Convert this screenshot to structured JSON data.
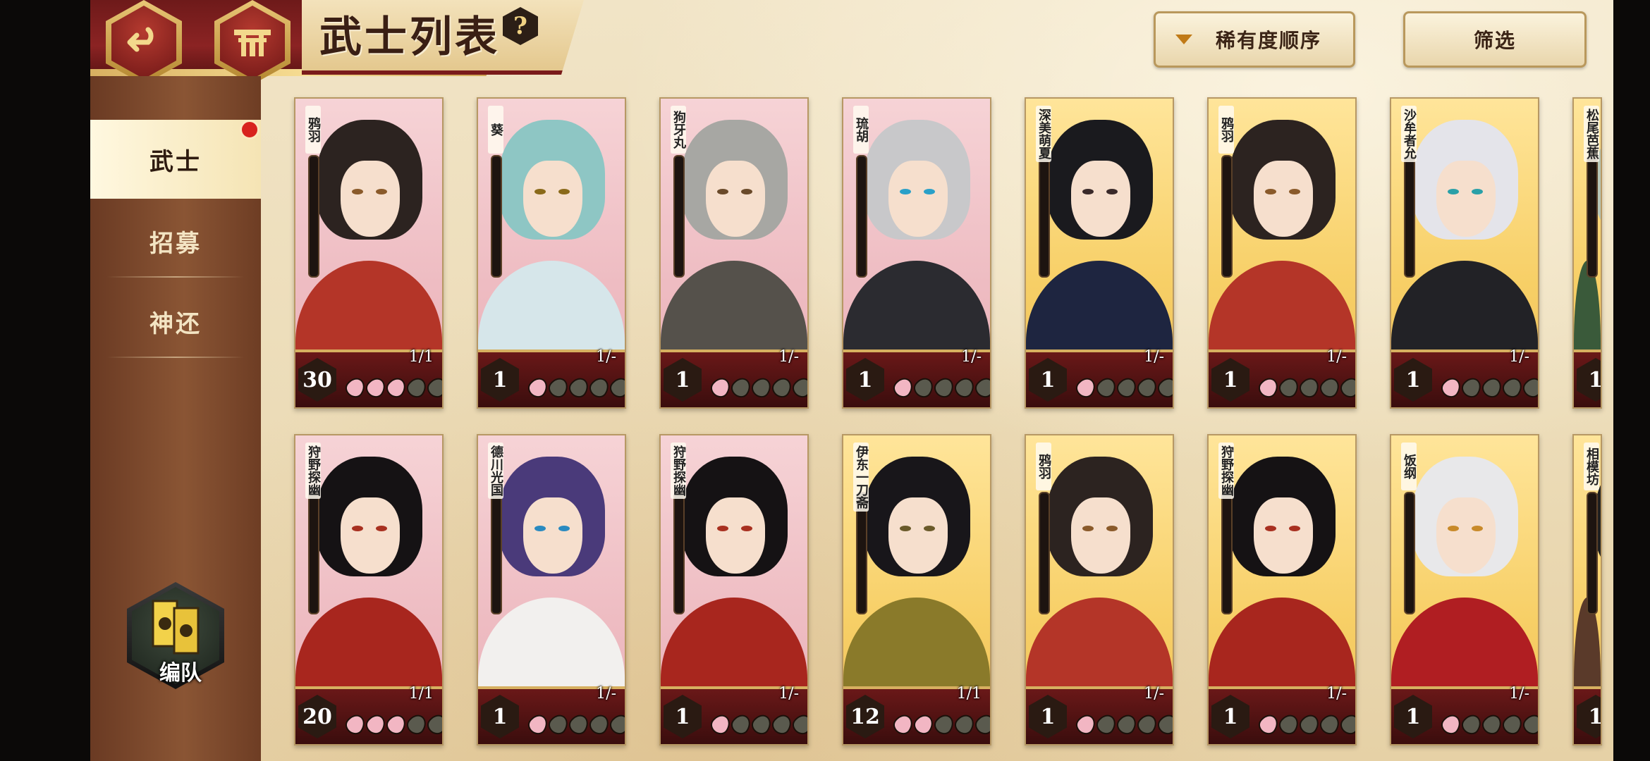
{
  "header": {
    "title": "武士列表",
    "help_label": "?",
    "sort_label": "稀有度顺序",
    "filter_label": "筛选"
  },
  "sidebar": {
    "tabs": [
      {
        "label": "武士",
        "active": true,
        "notification": true
      },
      {
        "label": "招募",
        "active": false
      },
      {
        "label": "神还",
        "active": false
      }
    ],
    "team_label": "编队"
  },
  "colors": {
    "accent_red": "#8b2323",
    "gold": "#d8b061",
    "panel_brown": "#7a4a2e",
    "petal_on": "#f2b6c3",
    "petal_off": "#5a5a4e"
  },
  "cards": [
    {
      "name": "鸦羽",
      "level": "30",
      "count": "1/1",
      "petals": 3,
      "bg": "pink",
      "hair": "#2c2320",
      "outfit": "#b43528",
      "eyes": "#8a5a2a"
    },
    {
      "name": "葵",
      "level": "1",
      "count": "1/-",
      "petals": 1,
      "bg": "pink",
      "hair": "#8ec6c4",
      "outfit": "#d6e6ea",
      "eyes": "#8a6a1a"
    },
    {
      "name": "狗牙丸",
      "level": "1",
      "count": "1/-",
      "petals": 1,
      "bg": "pink",
      "hair": "#a7a7a3",
      "outfit": "#55514b",
      "eyes": "#6a4a2a"
    },
    {
      "name": "琉胡",
      "level": "1",
      "count": "1/-",
      "petals": 1,
      "bg": "pink",
      "hair": "#c8c8ca",
      "outfit": "#2b2b30",
      "eyes": "#2aa0c8"
    },
    {
      "name": "深美萌夏",
      "level": "1",
      "count": "1/-",
      "petals": 1,
      "bg": "gold",
      "hair": "#1a1a1e",
      "outfit": "#1e2540",
      "eyes": "#3a2a2a"
    },
    {
      "name": "鸦羽",
      "level": "1",
      "count": "1/-",
      "petals": 1,
      "bg": "gold",
      "hair": "#2c2320",
      "outfit": "#b43528",
      "eyes": "#8a5a2a"
    },
    {
      "name": "沙牟者允",
      "level": "1",
      "count": "1/-",
      "petals": 1,
      "bg": "gold",
      "hair": "#e4e4ea",
      "outfit": "#222226",
      "eyes": "#2aa0a8"
    },
    {
      "name": "松尾芭蕉",
      "level": "1",
      "count": "",
      "petals": 0,
      "bg": "gold",
      "hair": "#b8c8b8",
      "outfit": "#3a5a3a",
      "eyes": "#3a3a3a"
    },
    {
      "name": "狩野探幽",
      "level": "20",
      "count": "1/1",
      "petals": 3,
      "bg": "pink",
      "hair": "#151214",
      "outfit": "#a8261e",
      "eyes": "#a83020"
    },
    {
      "name": "德川光国",
      "level": "1",
      "count": "1/-",
      "petals": 1,
      "bg": "pink",
      "hair": "#4a3a7a",
      "outfit": "#f2f0ee",
      "eyes": "#2a8ac0"
    },
    {
      "name": "狩野探幽",
      "level": "1",
      "count": "1/-",
      "petals": 1,
      "bg": "pink",
      "hair": "#151214",
      "outfit": "#a8261e",
      "eyes": "#a83020"
    },
    {
      "name": "伊东一刀斋",
      "level": "12",
      "count": "1/1",
      "petals": 2,
      "bg": "gold",
      "hair": "#18161a",
      "outfit": "#8a7a2a",
      "eyes": "#6a5a2a"
    },
    {
      "name": "鸦羽",
      "level": "1",
      "count": "1/-",
      "petals": 1,
      "bg": "gold",
      "hair": "#2c2320",
      "outfit": "#b43528",
      "eyes": "#8a5a2a"
    },
    {
      "name": "狩野探幽",
      "level": "1",
      "count": "1/-",
      "petals": 1,
      "bg": "gold",
      "hair": "#151214",
      "outfit": "#a8261e",
      "eyes": "#a83020"
    },
    {
      "name": "饭纲",
      "level": "1",
      "count": "1/-",
      "petals": 1,
      "bg": "gold",
      "hair": "#e8e8ea",
      "outfit": "#b01e22",
      "eyes": "#c88a2a"
    },
    {
      "name": "相模坊",
      "level": "1",
      "count": "",
      "petals": 0,
      "bg": "gold",
      "hair": "#202020",
      "outfit": "#5a3a2a",
      "eyes": "#3a3a3a"
    }
  ]
}
